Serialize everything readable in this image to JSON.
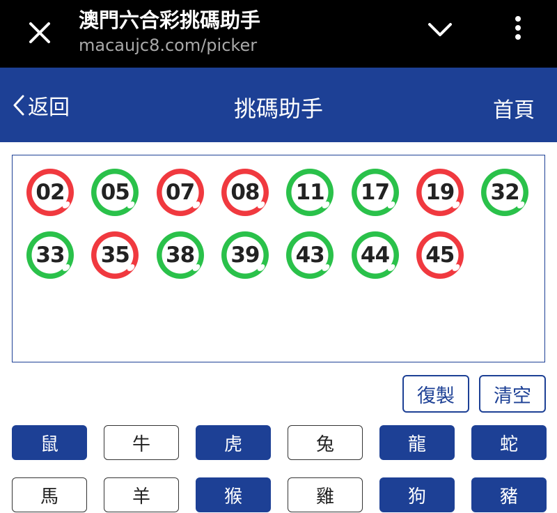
{
  "browser": {
    "title": "澳門六合彩挑碼助手",
    "url": "macaujc8.com/picker"
  },
  "header": {
    "back_label": "返回",
    "title": "挑碼助手",
    "home_label": "首頁"
  },
  "balls": [
    {
      "number": "02",
      "color": "red"
    },
    {
      "number": "05",
      "color": "green"
    },
    {
      "number": "07",
      "color": "red"
    },
    {
      "number": "08",
      "color": "red"
    },
    {
      "number": "11",
      "color": "green"
    },
    {
      "number": "17",
      "color": "green"
    },
    {
      "number": "19",
      "color": "red"
    },
    {
      "number": "32",
      "color": "green"
    },
    {
      "number": "33",
      "color": "green"
    },
    {
      "number": "35",
      "color": "red"
    },
    {
      "number": "38",
      "color": "green"
    },
    {
      "number": "39",
      "color": "green"
    },
    {
      "number": "43",
      "color": "green"
    },
    {
      "number": "44",
      "color": "green"
    },
    {
      "number": "45",
      "color": "red"
    }
  ],
  "ball_colors": {
    "red": "#f0393f",
    "green": "#2ac14a"
  },
  "actions": {
    "copy_label": "復製",
    "clear_label": "清空"
  },
  "zodiacs": [
    {
      "label": "鼠",
      "selected": true
    },
    {
      "label": "牛",
      "selected": false
    },
    {
      "label": "虎",
      "selected": true
    },
    {
      "label": "兔",
      "selected": false
    },
    {
      "label": "龍",
      "selected": true
    },
    {
      "label": "蛇",
      "selected": true
    },
    {
      "label": "馬",
      "selected": false
    },
    {
      "label": "羊",
      "selected": false
    },
    {
      "label": "猴",
      "selected": true
    },
    {
      "label": "雞",
      "selected": false
    },
    {
      "label": "狗",
      "selected": true
    },
    {
      "label": "豬",
      "selected": true
    }
  ],
  "colors": {
    "primary": "#1d4095",
    "browser_bar": "#000000"
  }
}
